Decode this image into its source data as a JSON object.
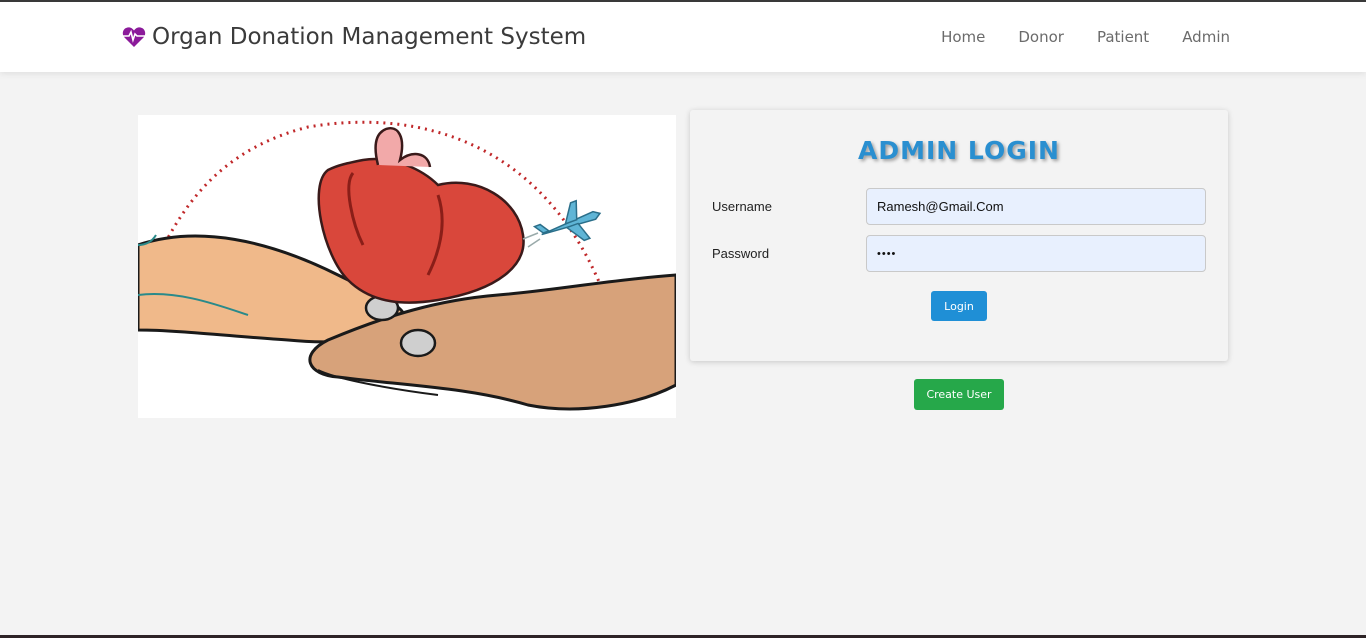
{
  "header": {
    "brand": "Organ Donation Management System",
    "nav": [
      "Home",
      "Donor",
      "Patient",
      "Admin"
    ]
  },
  "colors": {
    "brand_icon": "#8b1a9a",
    "title": "#2a8fd0",
    "login_button": "#1f8fd6",
    "create_button": "#26a84a"
  },
  "login": {
    "title": "ADMIN LOGIN",
    "username_label": "Username",
    "username_value": "Ramesh@Gmail.Com",
    "password_label": "Password",
    "password_value": "••••",
    "login_button": "Login"
  },
  "create_user_button": "Create User"
}
